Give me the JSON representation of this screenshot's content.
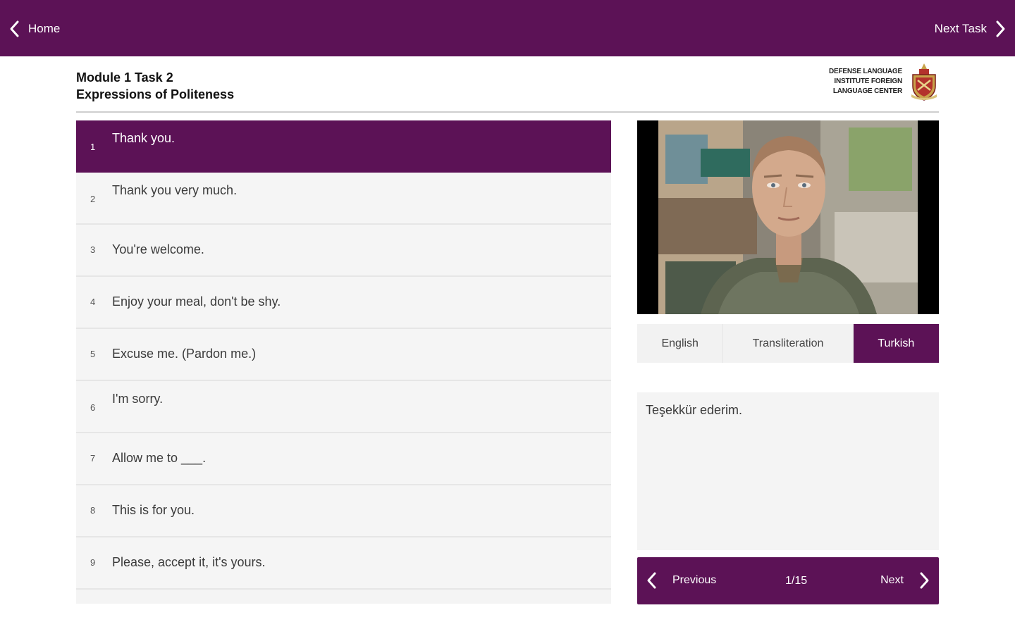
{
  "topbar": {
    "home_label": "Home",
    "next_task_label": "Next Task",
    "bg_color": "#5c1256"
  },
  "header": {
    "module": "Module 1 Task 2",
    "title": "Expressions of Politeness",
    "logo_lines": [
      "DEFENSE LANGUAGE",
      "INSTITUTE FOREIGN",
      "LANGUAGE CENTER"
    ]
  },
  "phrases": [
    {
      "num": "1",
      "text": "Thank you.",
      "active": true
    },
    {
      "num": "2",
      "text": "Thank you very much."
    },
    {
      "num": "3",
      "text": "You're welcome."
    },
    {
      "num": "4",
      "text": "Enjoy your meal, don't be shy."
    },
    {
      "num": "5",
      "text": "Excuse me. (Pardon me.)"
    },
    {
      "num": "6",
      "text": "I'm sorry."
    },
    {
      "num": "7",
      "text": "Allow me to ___."
    },
    {
      "num": "8",
      "text": "This is for you."
    },
    {
      "num": "9",
      "text": "Please, accept it, it's yours."
    }
  ],
  "tabs": {
    "english": "English",
    "transliteration": "Transliteration",
    "turkish": "Turkish",
    "active": "Turkish"
  },
  "translation": {
    "text": "Teşekkür ederim."
  },
  "pager": {
    "previous_label": "Previous",
    "next_label": "Next",
    "count": "1/15"
  },
  "icons": {
    "back": "chevron-left-icon",
    "forward": "chevron-right-icon",
    "logo": "crest-icon"
  }
}
